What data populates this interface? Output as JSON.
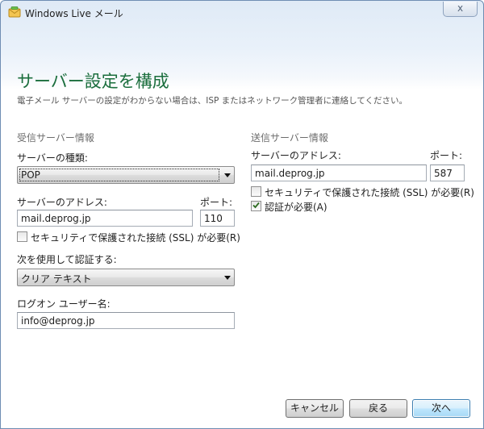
{
  "window": {
    "title": "Windows Live メール",
    "close_label": "x"
  },
  "header": {
    "title": "サーバー設定を構成",
    "subtitle": "電子メール サーバーの設定がわからない場合は、ISP またはネットワーク管理者に連絡してください。"
  },
  "incoming": {
    "heading": "受信サーバー情報",
    "server_type_label": "サーバーの種類:",
    "server_type_value": "POP",
    "address_label": "サーバーのアドレス:",
    "address_value": "mail.deprog.jp",
    "port_label": "ポート:",
    "port_value": "110",
    "ssl_label": "セキュリティで保護された接続 (SSL) が必要(R)",
    "ssl_checked": false,
    "auth_label": "次を使用して認証する:",
    "auth_value": "クリア テキスト",
    "logon_label": "ログオン ユーザー名:",
    "logon_value": "info@deprog.jp"
  },
  "outgoing": {
    "heading": "送信サーバー情報",
    "address_label": "サーバーのアドレス:",
    "address_value": "mail.deprog.jp",
    "port_label": "ポート:",
    "port_value": "587",
    "ssl_label": "セキュリティで保護された接続 (SSL) が必要(R)",
    "ssl_checked": false,
    "auth_required_label": "認証が必要(A)",
    "auth_required_checked": true
  },
  "footer": {
    "cancel_label": "キャンセル",
    "back_label": "戻る",
    "next_label": "次へ"
  },
  "colors": {
    "title_green": "#1b6e3d",
    "heading_gray": "#6d6d6d",
    "default_button_border": "#3c7fb1"
  }
}
